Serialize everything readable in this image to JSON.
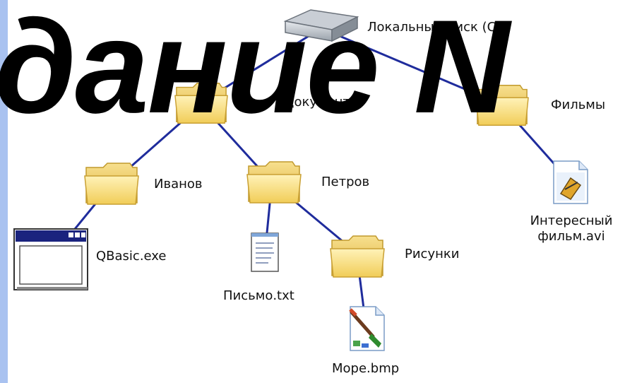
{
  "title": "дание N",
  "colors": {
    "edge": "#1f2c9c",
    "folder_fill": "#f5d774",
    "left_bar": "#a9c2f0"
  },
  "nodes": {
    "disk": {
      "label": "Локальный диск (C:)",
      "icon": "hard-drive-icon"
    },
    "documents": {
      "label": "документы",
      "icon": "folder-icon"
    },
    "films": {
      "label": "Фильмы",
      "icon": "folder-icon"
    },
    "ivanov": {
      "label": "Иванов",
      "icon": "folder-icon"
    },
    "petrov": {
      "label": "Петров",
      "icon": "folder-icon"
    },
    "qbasic": {
      "label": "QBasic.exe",
      "icon": "application-window-icon"
    },
    "letter": {
      "label": "Письмо.txt",
      "icon": "text-file-icon"
    },
    "pictures": {
      "label": "Рисунки",
      "icon": "folder-icon"
    },
    "sea": {
      "label": "Море.bmp",
      "icon": "paint-brush-image-icon"
    },
    "movie": {
      "label_line1": "Интересный",
      "label_line2": "фильм.avi",
      "icon": "video-file-icon"
    }
  }
}
